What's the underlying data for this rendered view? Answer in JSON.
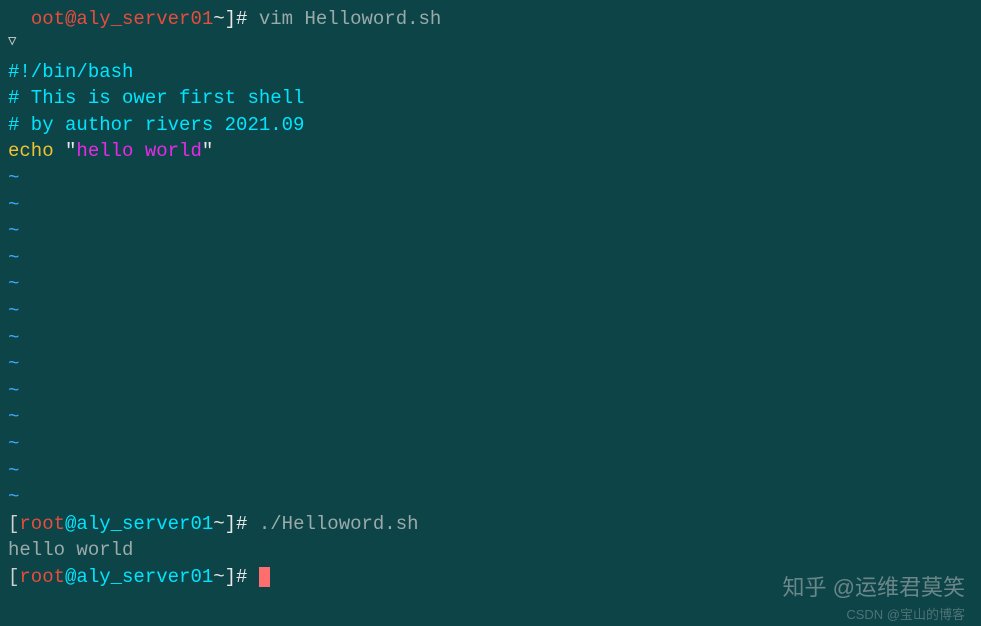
{
  "prompt1": {
    "pre_space": "  ",
    "user_host": "oot@aly_server01",
    "path": "~",
    "end": "]#",
    "command": "vim Helloword.sh"
  },
  "arrow": "▽",
  "script": {
    "shebang": "#!/bin/bash",
    "comment1": "# This is ower first shell",
    "comment2": "# by author rivers 2021.09",
    "echo_cmd": "echo",
    "echo_q_open": " \"",
    "echo_str": "hello world",
    "echo_q_close": "\""
  },
  "tilde": "~",
  "prompt2": {
    "open": "[",
    "user": "root",
    "at": "@",
    "host": "aly_server01",
    "path": "~",
    "end": "]#",
    "command": "./Helloword.sh"
  },
  "output": "hello world",
  "prompt3": {
    "open": "[",
    "user": "root",
    "at": "@",
    "host": "aly_server01",
    "path": "~",
    "end": "]# "
  },
  "watermark1": "知乎 @运维君莫笑",
  "watermark2": "CSDN @宝山的博客"
}
